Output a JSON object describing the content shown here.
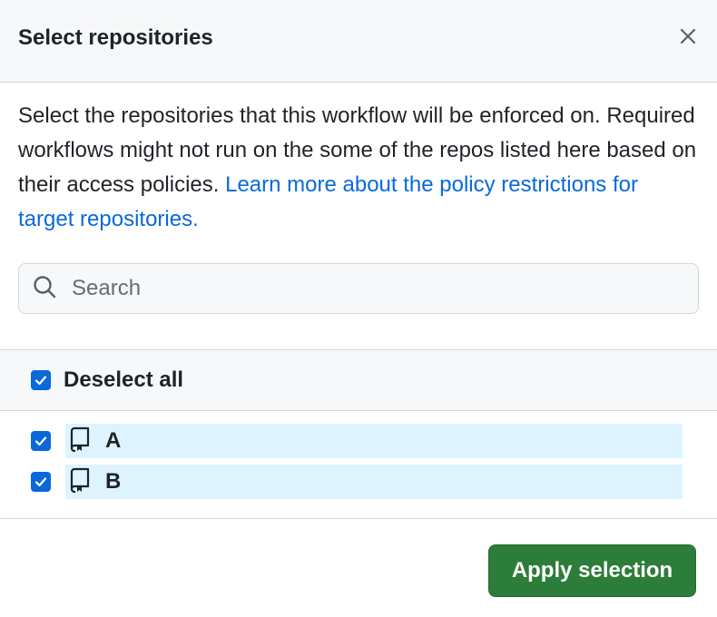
{
  "dialog": {
    "title": "Select repositories",
    "close_icon": "close-icon"
  },
  "description": {
    "text": "Select the repositories that this workflow will be enforced on. Required workflows might not run on the some of the repos listed here based on their access policies. ",
    "link_text": "Learn more about the policy restrictions for target repositories."
  },
  "search": {
    "placeholder": "Search",
    "value": "",
    "icon": "search-icon"
  },
  "select_all": {
    "label": "Deselect all",
    "checked": true
  },
  "repositories": [
    {
      "name": "A",
      "checked": true,
      "icon": "repo-icon"
    },
    {
      "name": "B",
      "checked": true,
      "icon": "repo-icon"
    }
  ],
  "footer": {
    "apply_label": "Apply selection"
  },
  "colors": {
    "accent": "#0969da",
    "primary_button": "#2d7d3a",
    "selected_row": "#ddf4ff",
    "header_bg": "#f6f8fa"
  }
}
